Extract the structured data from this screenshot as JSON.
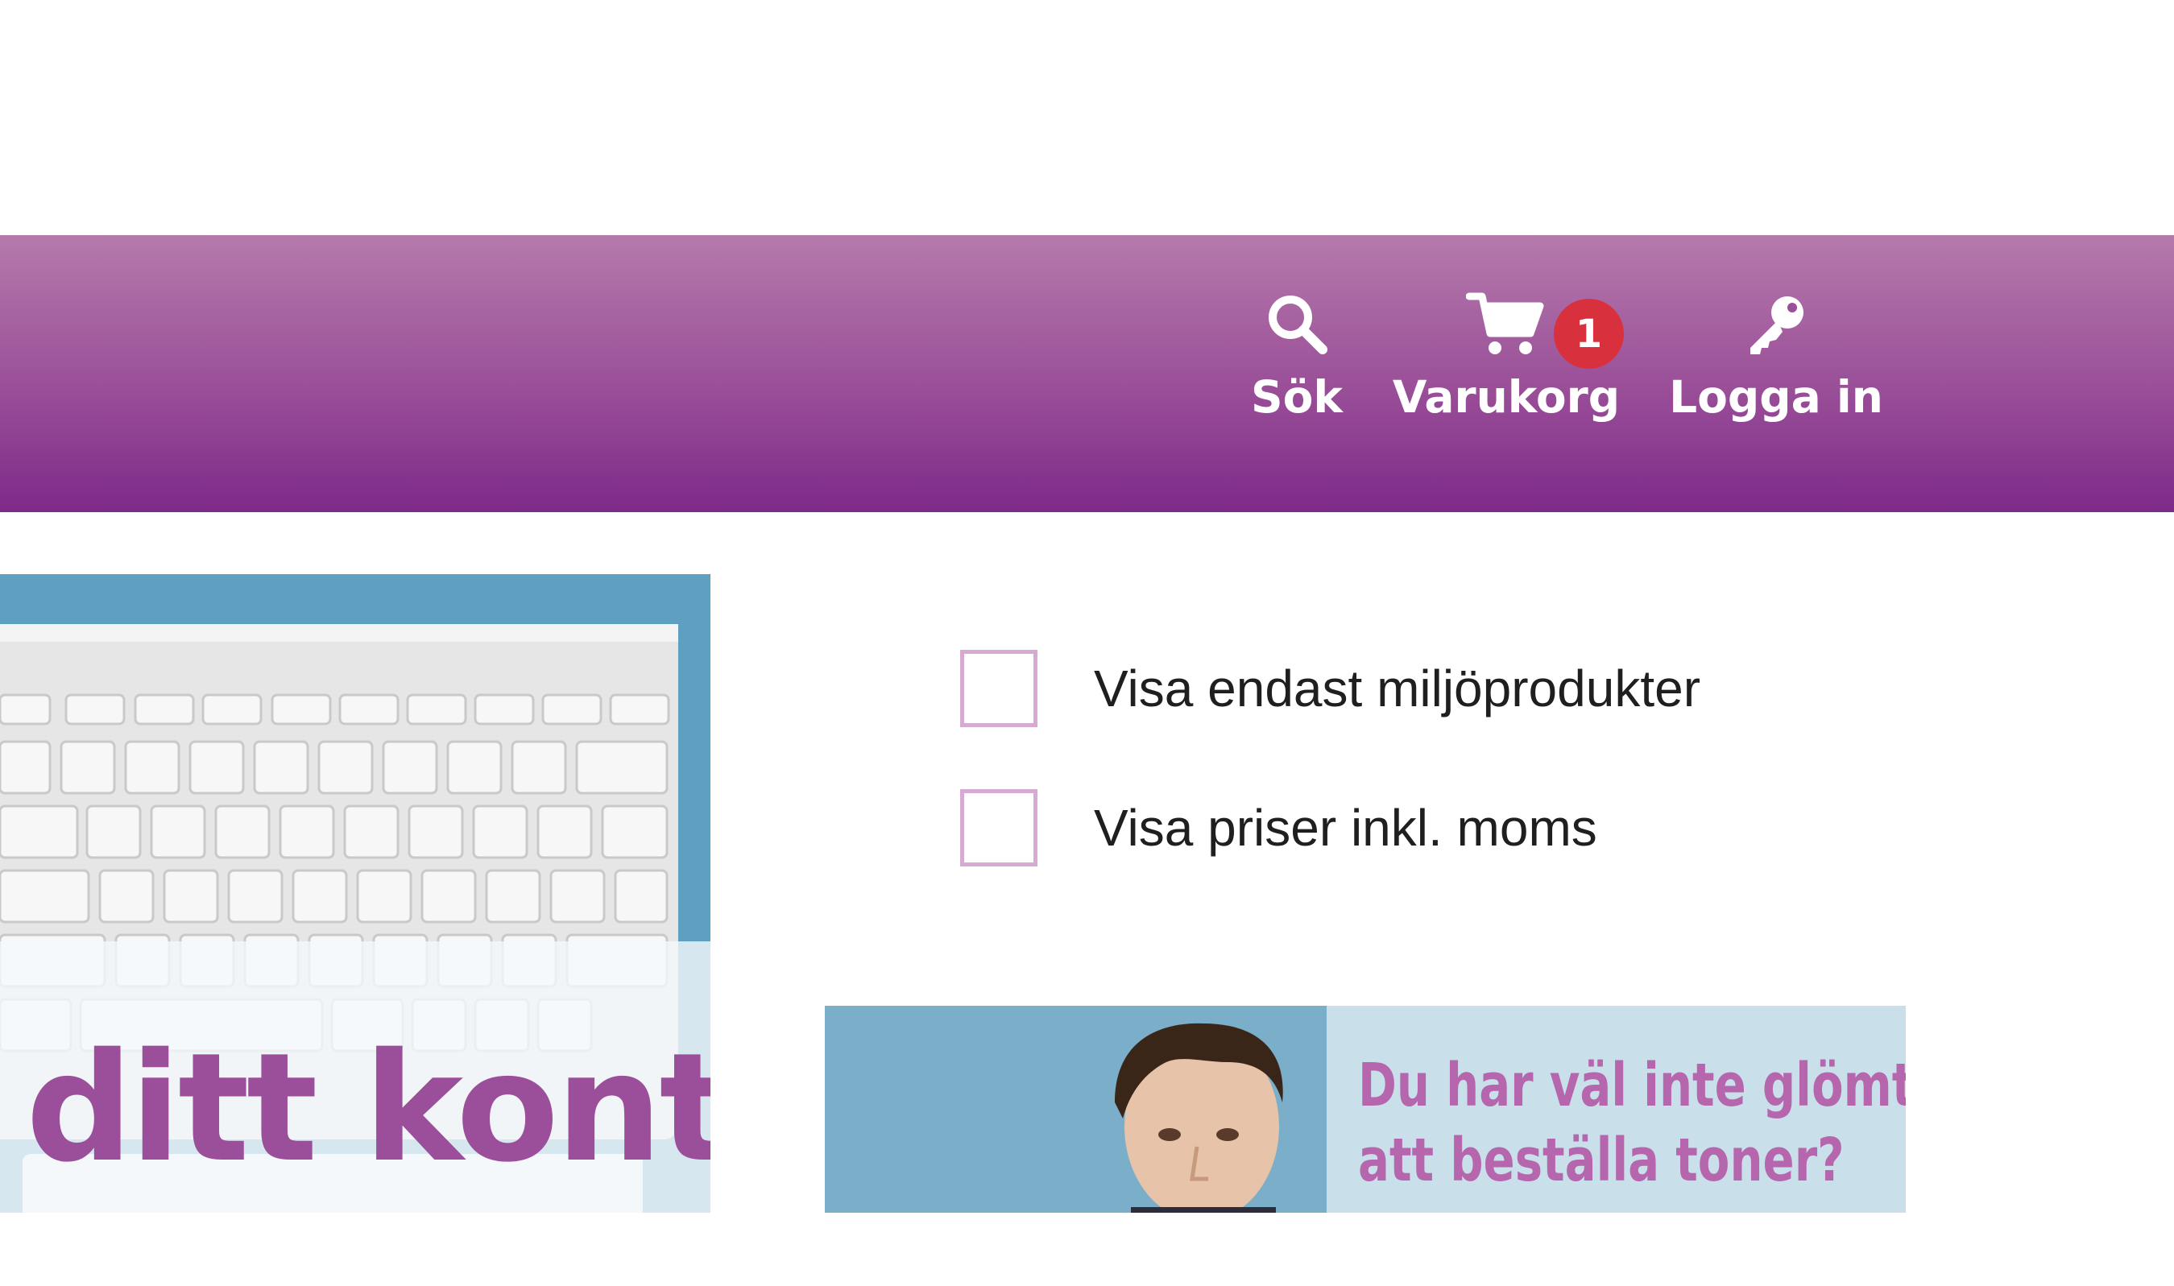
{
  "header": {
    "nav": {
      "search_label": "Sök",
      "cart_label": "Varukorg",
      "cart_count": "1",
      "login_label": "Logga in"
    }
  },
  "filters": {
    "eco_only_label": "Visa endast miljöprodukter",
    "eco_only_checked": false,
    "incl_vat_label": "Visa priser inkl. moms",
    "incl_vat_checked": false
  },
  "promos": {
    "left_banner_text": "ditt kontor",
    "right_banner_line1": "Du har väl inte glömt",
    "right_banner_line2": "att beställa toner?"
  },
  "colors": {
    "header_gradient_top": "#b57aac",
    "header_gradient_bottom": "#7d2a8a",
    "badge": "#d9303e",
    "checkbox_border": "#d7aad3",
    "promo_text": "#9b4f9b"
  },
  "icons": {
    "search": "search-icon",
    "cart": "shopping-cart-icon",
    "login": "key-icon"
  }
}
